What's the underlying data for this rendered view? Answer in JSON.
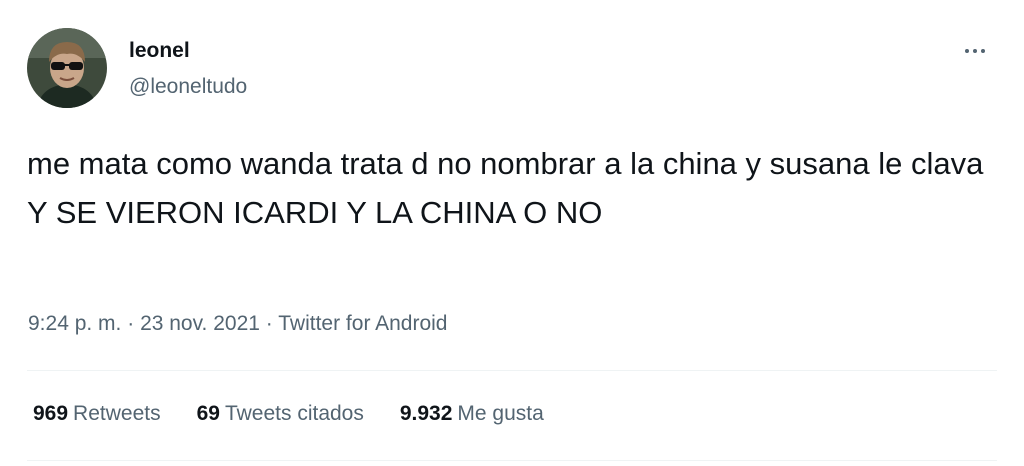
{
  "user": {
    "display_name": "leonel",
    "handle": "@leoneltudo"
  },
  "tweet": {
    "text": "me mata como wanda trata d no nombrar a la china y susana le clava Y SE VIERON ICARDI Y LA CHINA O NO",
    "time": "9:24 p. m.",
    "separator": "·",
    "date": "23 nov. 2021",
    "source": "Twitter for Android"
  },
  "stats": {
    "retweets_count": "969",
    "retweets_label": "Retweets",
    "quotes_count": "69",
    "quotes_label": "Tweets citados",
    "likes_count": "9.932",
    "likes_label": "Me gusta"
  },
  "icons": {
    "more": "more-horizontal-icon"
  },
  "colors": {
    "primary_text": "#0f1419",
    "secondary_text": "#536471",
    "divider": "#eff3f4"
  }
}
